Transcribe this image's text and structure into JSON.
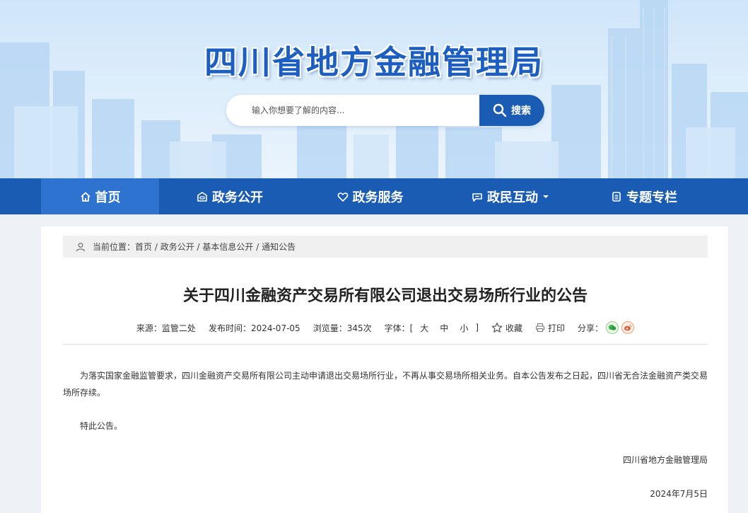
{
  "site": {
    "title": "四川省地方金融管理局",
    "search_placeholder": "输入你想要了解的内容...",
    "search_button": "搜索",
    "accent_color": "#1a5bb3"
  },
  "nav": {
    "items": [
      {
        "label": "首页",
        "icon": "home-icon"
      },
      {
        "label": "政务公开",
        "icon": "building-icon"
      },
      {
        "label": "政务服务",
        "icon": "heart-icon"
      },
      {
        "label": "政民互动",
        "icon": "chat-icon"
      },
      {
        "label": "专题专栏",
        "icon": "document-icon"
      }
    ]
  },
  "breadcrumb": {
    "prefix": "当前位置：",
    "items": [
      "首页",
      "政务公开",
      "基本信息公开",
      "通知公告"
    ],
    "sep": " / "
  },
  "article": {
    "title": "关于四川金融资产交易所有限公司退出交易场所行业的公告",
    "source": "来源：监管二处",
    "date": "发布时间：2024-07-05",
    "views": "浏览量：345次",
    "font_label": "字体：[",
    "size_large": "大",
    "size_medium": "中",
    "size_small": "小",
    "font_close": "]",
    "favorite": "收藏",
    "print": "打印",
    "share": "分享：",
    "body": "为落实国家金融监管要求，四川金融资产交易所有限公司主动申请退出交易场所行业，不再从事交易场所相关业务。自本公告发布之日起，四川省无合法金融资产类交易场所存续。",
    "closing": "特此公告。",
    "signature": "四川省地方金融管理局",
    "sign_date": "2024年7月5日"
  }
}
